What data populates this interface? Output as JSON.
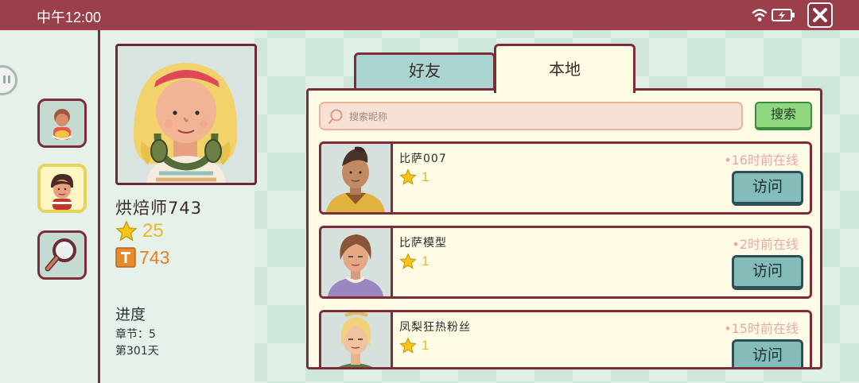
{
  "status_bar": {
    "time": "中午12:00"
  },
  "player": {
    "name": "烘焙师743",
    "stars": "25",
    "tickets": "743",
    "progress_title": "进度",
    "chapter": "章节：5",
    "day": "第301天"
  },
  "tabs": [
    {
      "label": "好友",
      "active": false
    },
    {
      "label": "本地",
      "active": true
    }
  ],
  "search": {
    "placeholder": "搜索昵称",
    "button_label": "搜索"
  },
  "friends": [
    {
      "name": "比萨007",
      "stars": "1",
      "status": "16时前在线",
      "visit_label": "访问"
    },
    {
      "name": "比萨模型",
      "stars": "1",
      "status": "2时前在线",
      "visit_label": "访问"
    },
    {
      "name": "凤梨狂热粉丝",
      "stars": "1",
      "status": "15时前在线",
      "visit_label": "访问"
    }
  ],
  "colors": {
    "top_bar": "#9b3f4b",
    "border": "#7d2d3a",
    "card_bg": "#fffbe4",
    "visit_button": "#83bcb9",
    "search_button": "#8fd880",
    "star": "#e6b92a",
    "ticket": "#e67e22"
  },
  "icons": {
    "nav": [
      "recipe-chef-icon",
      "friend-avatar-icon",
      "magnifier-icon"
    ],
    "status": [
      "wifi-icon",
      "battery-icon",
      "close-icon"
    ]
  }
}
